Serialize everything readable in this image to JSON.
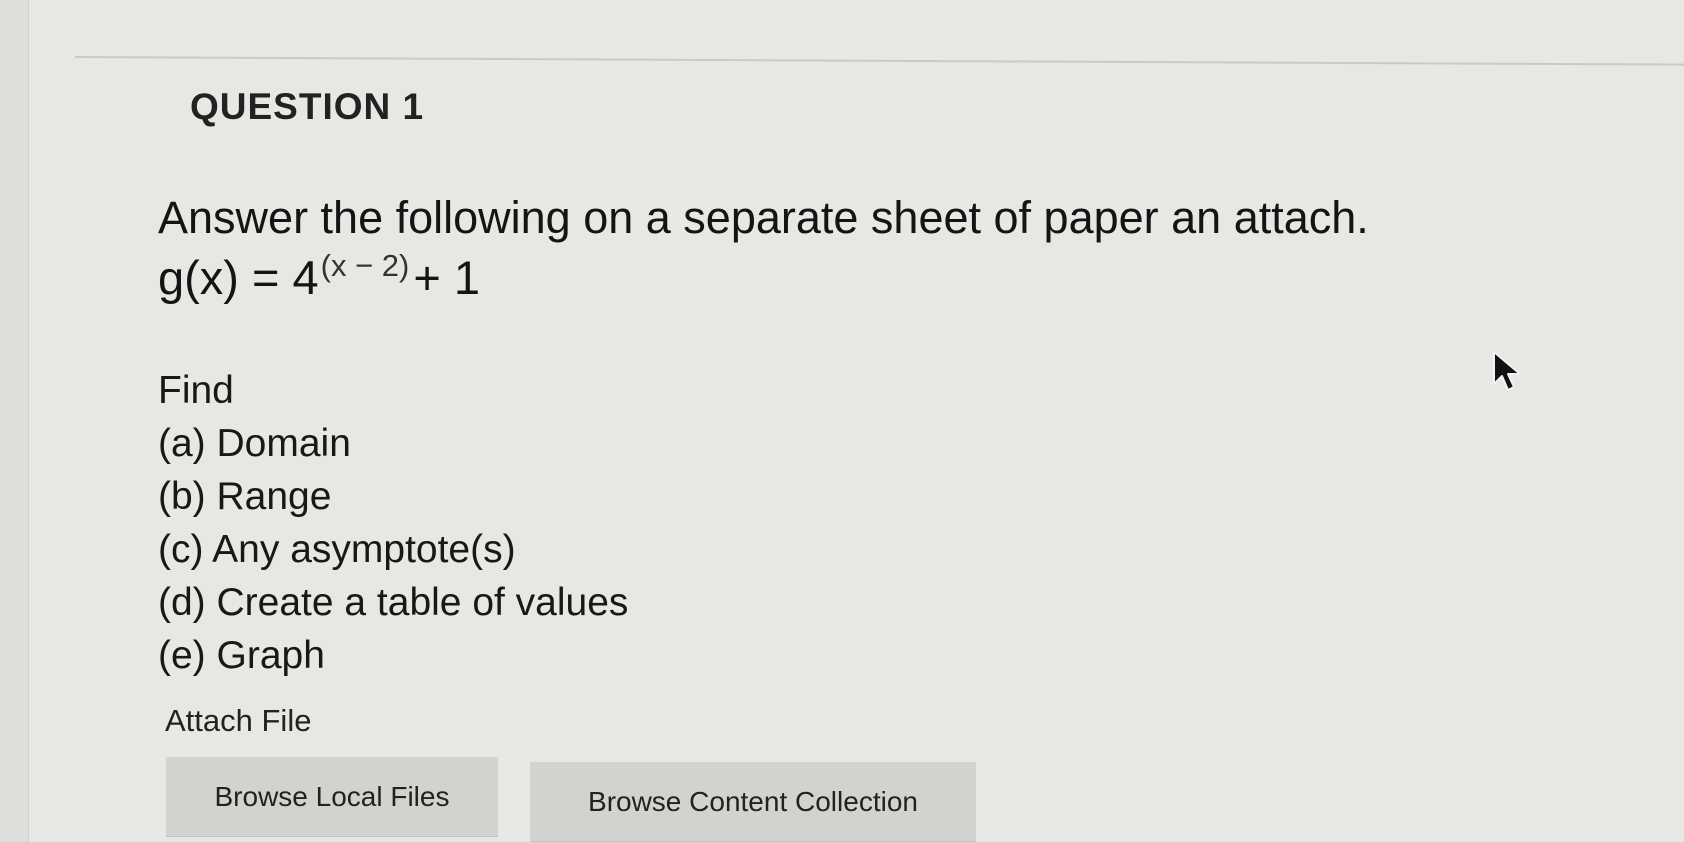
{
  "question": {
    "heading": "QUESTION 1",
    "instruction": "Answer the following on a separate sheet of paper an attach.",
    "equation": {
      "lhs": "g(x) = 4",
      "exponent": "(x − 2)",
      "rhs": "+ 1"
    },
    "find_label": "Find",
    "items": [
      "(a) Domain",
      "(b) Range",
      "(c) Any asymptote(s)",
      "(d) Create a table of values",
      "(e) Graph"
    ]
  },
  "attach": {
    "label": "Attach File",
    "browse_local_label": "Browse Local Files",
    "browse_content_label": "Browse Content Collection"
  },
  "icons": {
    "cursor": "mouse-pointer-icon"
  }
}
